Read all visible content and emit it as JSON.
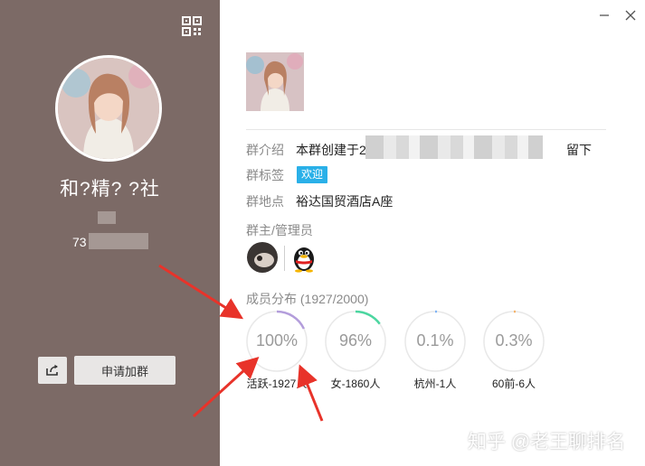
{
  "left_panel": {
    "group_name": "和?精?      ?社",
    "group_id": "73"
  },
  "buttons": {
    "join_label": "申请加群"
  },
  "info": {
    "intro_label": "群介绍",
    "intro_value": "本群创建于2",
    "intro_tail": "留下",
    "tags_label": "群标签",
    "tag": "欢迎",
    "location_label": "群地点",
    "location_value": "裕达国贸酒店A座",
    "admins_label": "群主/管理员"
  },
  "members": {
    "title": "成员分布",
    "count": "(1927/2000)",
    "stats": [
      {
        "percent_text": "100%",
        "label": "活跃-1927人",
        "fraction": 0.18,
        "color": "#b39ddb"
      },
      {
        "percent_text": "96%",
        "label": "女-1860人",
        "fraction": 0.15,
        "color": "#4cd6a0"
      },
      {
        "percent_text": "0.1%",
        "label": "杭州-1人",
        "fraction": 0.01,
        "color": "#7fb4f5"
      },
      {
        "percent_text": "0.3%",
        "label": "60前-6人",
        "fraction": 0.01,
        "color": "#f5b36b"
      }
    ]
  },
  "watermark": "知乎 @老王聊排名",
  "colors": {
    "left_panel_bg": "#7c6a66",
    "tag_bg": "#2ab0e8",
    "arrow": "#e8332a"
  },
  "icons": [
    "qr-code-icon",
    "share-icon",
    "minimize-icon",
    "close-icon",
    "qq-penguin-icon"
  ]
}
